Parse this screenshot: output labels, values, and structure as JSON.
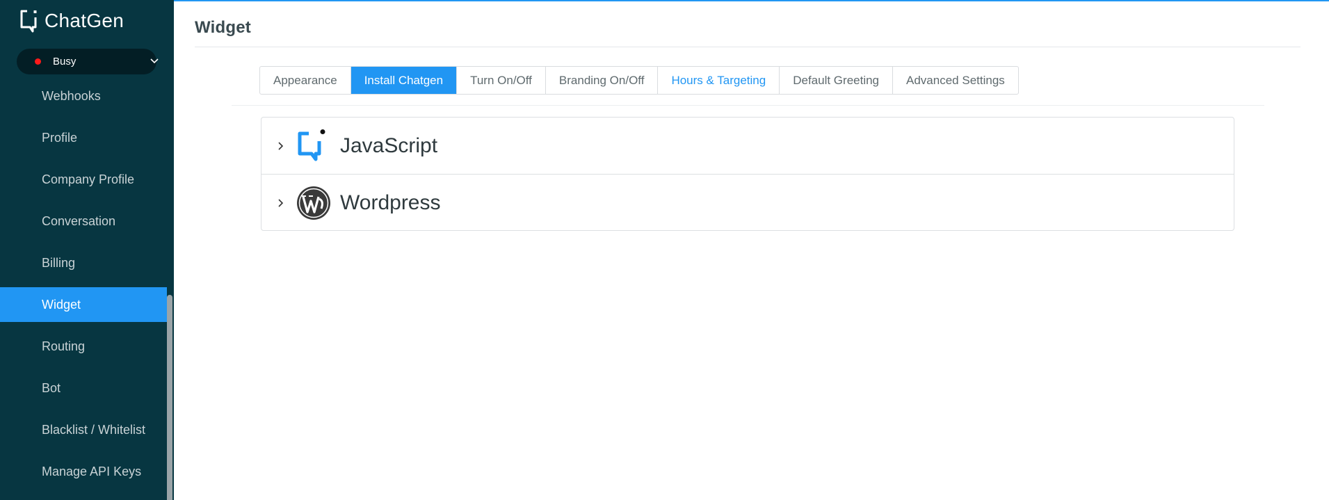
{
  "app": {
    "name": "ChatGen"
  },
  "status": {
    "label": "Busy",
    "color": "#ff1a1a"
  },
  "colors": {
    "accent": "#2196f3",
    "sidebar": "#073641"
  },
  "sidebar": {
    "items": [
      {
        "label": "Webhooks"
      },
      {
        "label": "Profile"
      },
      {
        "label": "Company Profile"
      },
      {
        "label": "Conversation"
      },
      {
        "label": "Billing"
      },
      {
        "label": "Widget",
        "active": true
      },
      {
        "label": "Routing"
      },
      {
        "label": "Bot"
      },
      {
        "label": "Blacklist / Whitelist"
      },
      {
        "label": "Manage API Keys"
      }
    ]
  },
  "page": {
    "title": "Widget"
  },
  "tabs": [
    {
      "label": "Appearance"
    },
    {
      "label": "Install Chatgen",
      "active": true
    },
    {
      "label": "Turn On/Off"
    },
    {
      "label": "Branding On/Off"
    },
    {
      "label": "Hours & Targeting"
    },
    {
      "label": "Default Greeting"
    },
    {
      "label": "Advanced Settings"
    }
  ],
  "install_options": [
    {
      "label": "JavaScript",
      "icon": "chatgen-icon"
    },
    {
      "label": "Wordpress",
      "icon": "wordpress-icon"
    }
  ]
}
